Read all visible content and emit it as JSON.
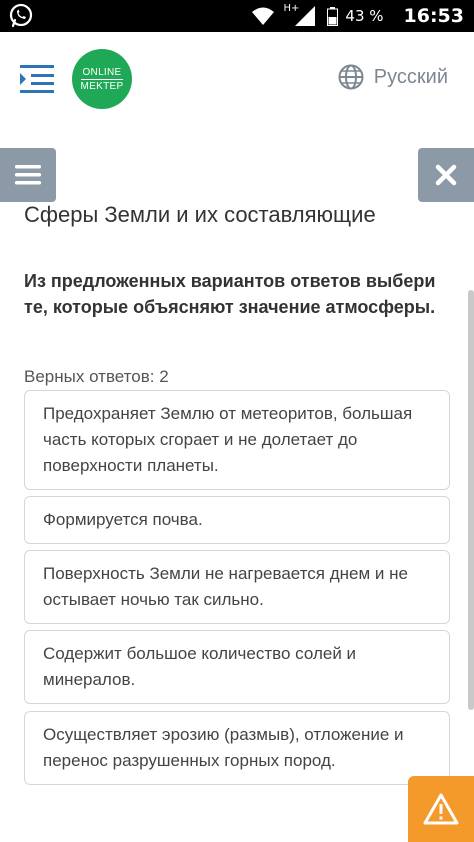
{
  "status_bar": {
    "network": "H+",
    "battery": "43 %",
    "time": "16:53"
  },
  "header": {
    "logo_line1": "ONLINE",
    "logo_line2": "MEKTEP",
    "language": "Русский"
  },
  "content": {
    "title": "Сферы Земли и их составляющие",
    "question": "Из предложенных вариантов ответов выбери те, которые объясняют значение атмосферы.",
    "correct_count": "Верных ответов: 2",
    "answers": [
      "Предохраняет Землю от метеоритов, большая часть которых сгорает и не долетает до поверхности планеты.",
      "Формируется почва.",
      "Поверхность Земли не нагревается днем и не остывает ночью так сильно.",
      "Содержит большое количество солей и минералов.",
      "Осуществляет эрозию (размыв), отложение и перенос разрушенных горных пород."
    ]
  },
  "icons": {
    "whatsapp": "whatsapp-icon",
    "menu": "menu-icon",
    "globe": "globe-icon",
    "close": "close-icon",
    "warning": "warning-icon"
  },
  "colors": {
    "logo_green": "#1fa856",
    "menu_blue": "#2d75b6",
    "side_button_gray": "#8c9aa8",
    "warning_orange": "#f49a2a"
  }
}
